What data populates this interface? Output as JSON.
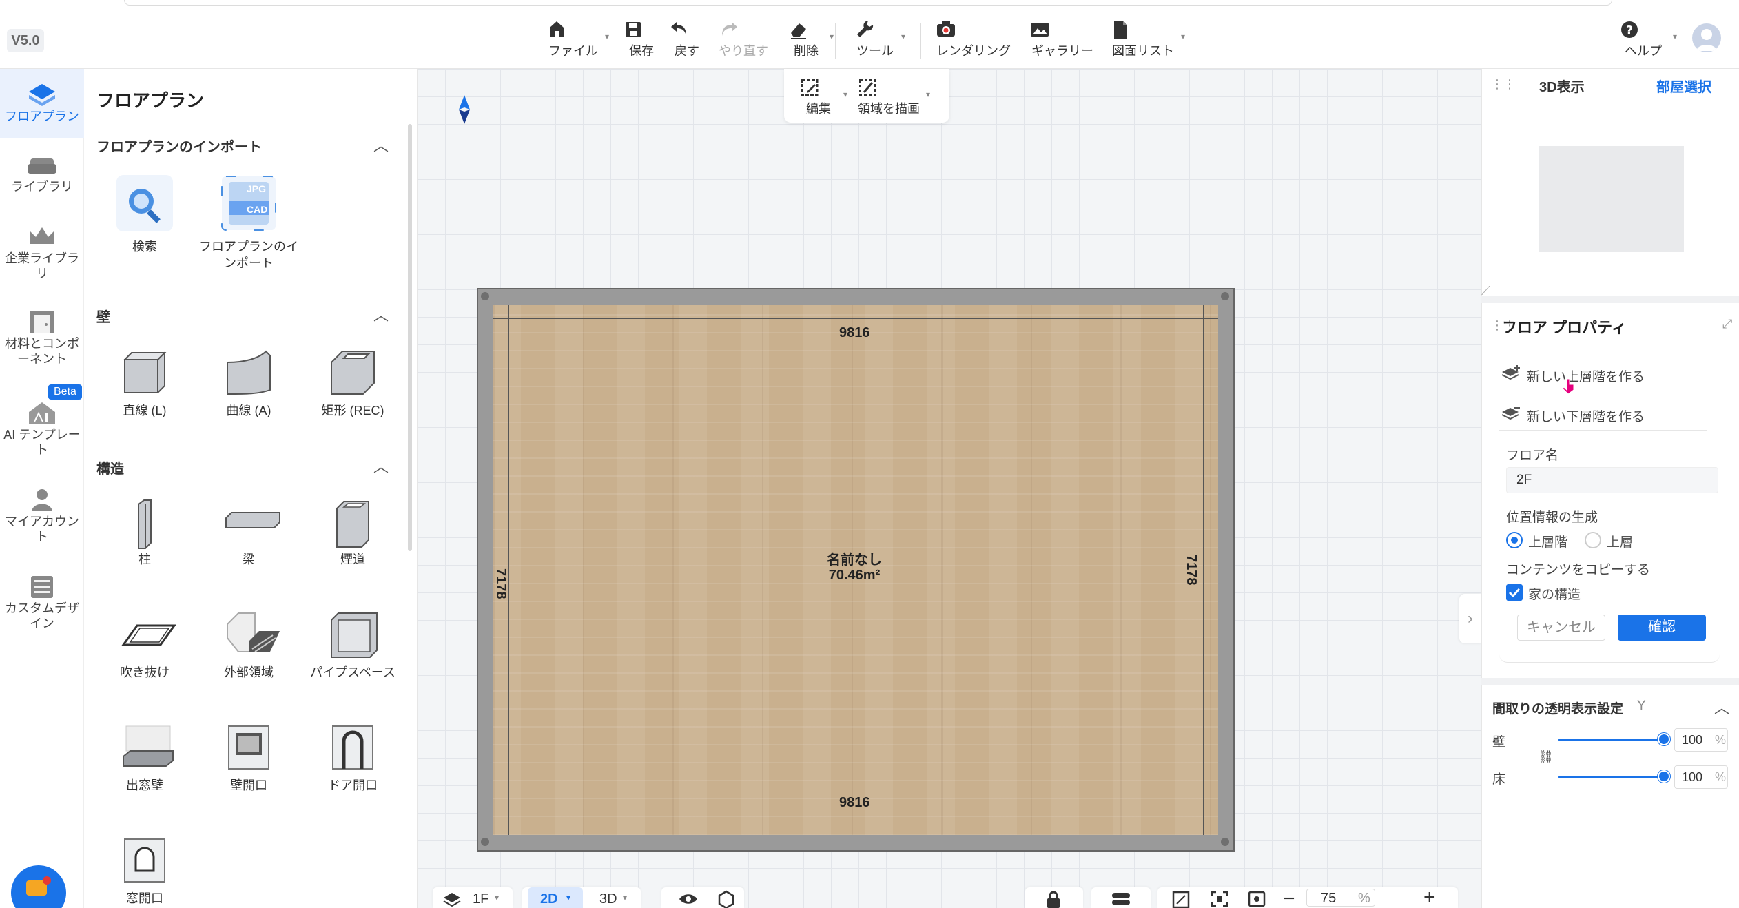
{
  "app": {
    "version": "V5.0"
  },
  "toolbar": {
    "file": "ファイル",
    "save": "保存",
    "undo": "戻す",
    "redo": "やり直す",
    "delete": "削除",
    "tools": "ツール",
    "rendering": "レンダリング",
    "gallery": "ギャラリー",
    "drawing_list": "図面リスト",
    "help": "ヘルプ"
  },
  "canvas_toolbar": {
    "edit": "編集",
    "draw_area": "領域を描画"
  },
  "rail": {
    "items": [
      {
        "label": "フロアプラン",
        "icon": "floorplan-icon",
        "active": true
      },
      {
        "label": "ライブラリ",
        "icon": "sofa-icon"
      },
      {
        "label": "企業ライブラリ",
        "icon": "crown-icon"
      },
      {
        "label": "材料とコンポーネント",
        "icon": "door-icon"
      },
      {
        "label": "AI テンプレート",
        "icon": "ai-house-icon",
        "badge": "Beta"
      },
      {
        "label": "マイアカウント",
        "icon": "user-icon"
      },
      {
        "label": "カスタムデザイン",
        "icon": "cabinet-icon"
      }
    ]
  },
  "left_panel": {
    "title": "フロアプラン",
    "sections": {
      "import": {
        "title": "フロアプランのインポート",
        "items": [
          "検索",
          "フロアプランのインポート"
        ]
      },
      "wall": {
        "title": "壁",
        "items": [
          "直線 (L)",
          "曲線 (A)",
          "矩形 (REC)"
        ]
      },
      "structure": {
        "title": "構造",
        "items": [
          "柱",
          "梁",
          "煙道",
          "吹き抜け",
          "外部領域",
          "パイプスペース",
          "出窓壁",
          "壁開口",
          "ドア開口",
          "窓開口"
        ]
      }
    },
    "import_badges": {
      "jpg": "JPG",
      "cad": "CAD"
    }
  },
  "room": {
    "name": "名前なし",
    "area": "70.46m²",
    "dim_top": "9816",
    "dim_bottom": "9816",
    "dim_left": "7178",
    "dim_right": "7178"
  },
  "bottom_bar": {
    "floor": "1F",
    "mode_2d": "2D",
    "mode_3d": "3D",
    "zoom": "75",
    "zoom_unit": "%"
  },
  "right_panel": {
    "view_3d": "3D表示",
    "room_select": "部屋選択",
    "floor_props_title": "フロア プロパティ",
    "new_upper": "新しい上層階を作る",
    "new_lower": "新しい下層階を作る",
    "floor_name_label": "フロア名",
    "floor_name_value": "2F",
    "position_label": "位置情報の生成",
    "radio_upper_floor": "上層階",
    "radio_upper": "上層",
    "copy_label": "コンテンツをコピーする",
    "checkbox_structure": "家の構造",
    "cancel": "キャンセル",
    "confirm": "確認",
    "transparency_title": "間取りの透明表示設定",
    "transparency_key": "Y",
    "wall_label": "壁",
    "floor_label": "床",
    "wall_value": "100",
    "floor_value": "100",
    "pct": "%"
  },
  "colors": {
    "accent": "#1a73e8",
    "floor_wood": "#c9b08e",
    "wall_gray": "#9a9a9a"
  }
}
